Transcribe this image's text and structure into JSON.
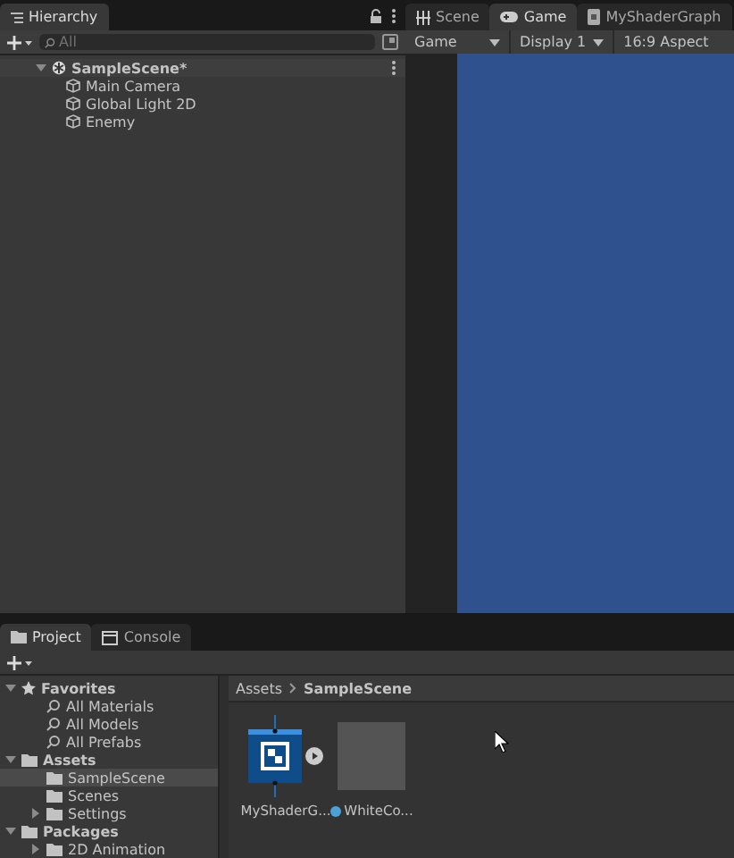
{
  "hierarchy": {
    "tab": "Hierarchy",
    "search": {
      "placeholder": "All"
    },
    "scene": {
      "name": "SampleScene*",
      "expanded": true,
      "children": [
        {
          "name": "Main Camera"
        },
        {
          "name": "Global Light 2D"
        },
        {
          "name": "Enemy"
        }
      ]
    }
  },
  "view_tabs": [
    {
      "label": "Scene",
      "kind": "scene",
      "selected": false
    },
    {
      "label": "Game",
      "kind": "game",
      "selected": true
    },
    {
      "label": "MyShaderGraph",
      "kind": "shader",
      "selected": false
    }
  ],
  "game_toolbar": {
    "mode": "Game",
    "display": "Display 1",
    "aspect": "16:9 Aspect"
  },
  "bottom_tabs": [
    {
      "label": "Project",
      "kind": "project",
      "selected": true
    },
    {
      "label": "Console",
      "kind": "console",
      "selected": false
    }
  ],
  "project_tree": [
    {
      "label": "Favorites",
      "kind": "favorites",
      "expanded": true,
      "selected": false,
      "children": [
        {
          "label": "All Materials",
          "kind": "search",
          "selected": false
        },
        {
          "label": "All Models",
          "kind": "search",
          "selected": false
        },
        {
          "label": "All Prefabs",
          "kind": "search",
          "selected": false
        }
      ]
    },
    {
      "label": "Assets",
      "kind": "folder",
      "expanded": true,
      "selected": false,
      "children": [
        {
          "label": "SampleScene",
          "kind": "folder",
          "selected": true
        },
        {
          "label": "Scenes",
          "kind": "folder",
          "selected": false
        },
        {
          "label": "Settings",
          "kind": "folder",
          "expanded": false,
          "selected": false
        }
      ]
    },
    {
      "label": "Packages",
      "kind": "folder",
      "expanded": true,
      "selected": false,
      "children": [
        {
          "label": "2D Animation",
          "kind": "folder",
          "expanded": false,
          "selected": false
        }
      ]
    }
  ],
  "breadcrumb": [
    "Assets",
    "SampleScene"
  ],
  "assets": [
    {
      "name": "MyShaderG...",
      "kind": "shadergraph"
    },
    {
      "name": "WhiteCo...",
      "kind": "material"
    }
  ]
}
